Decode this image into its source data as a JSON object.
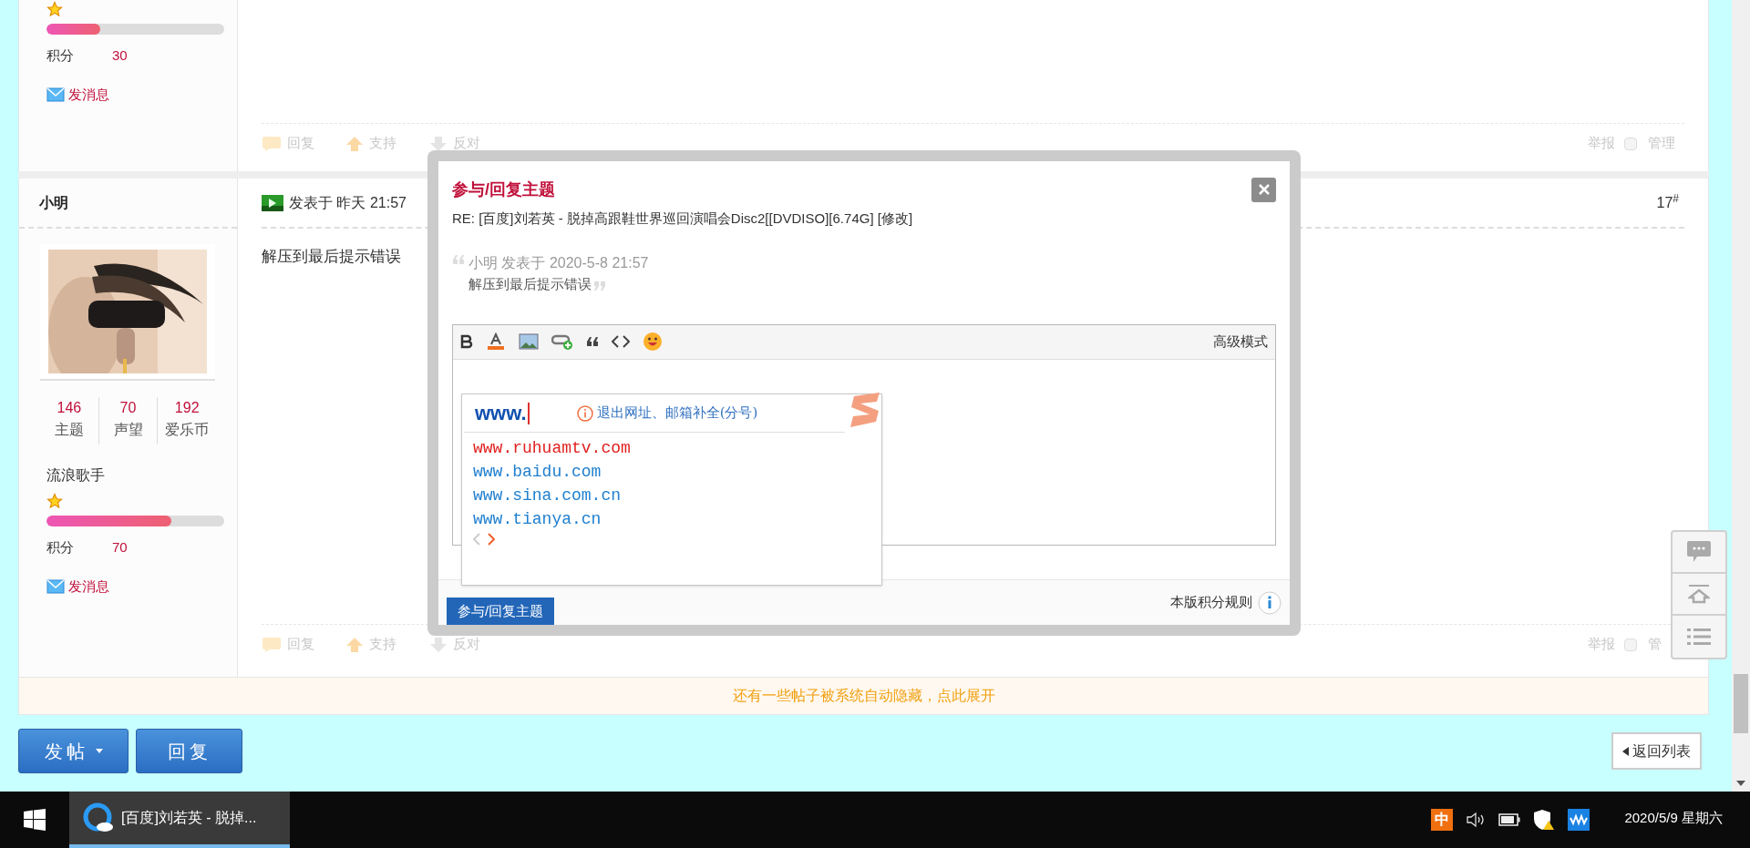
{
  "previous_post": {
    "level": 0.3,
    "points_label": "积分",
    "points": "30",
    "message_link": "发消息",
    "actions": [
      "回复",
      "支持",
      "反对"
    ],
    "report": "举报",
    "manage": "管理",
    "manage_checked": false
  },
  "post": {
    "author": "小明",
    "posted": "发表于 昨天 21:57",
    "floor": "17$^{#}$",
    "body": "解压到最后提示错误",
    "stats": [
      {
        "value": "146",
        "label": "主题"
      },
      {
        "value": "70",
        "label": "声望"
      },
      {
        "value": "192",
        "label": "爱乐币"
      }
    ],
    "rank": "流浪歌手",
    "level": 0.7,
    "points_label": "积分",
    "points": "70",
    "message_link": "发消息",
    "actions": [
      "回复",
      "支持",
      "反对"
    ],
    "report": "举报",
    "manage": "管",
    "manage_checked": false
  },
  "hidden_notice": "还有一些帖子被系统自动隐藏，点此展开",
  "buttons": {
    "new_post": "发帖",
    "reply": "回复",
    "back": "返回列表"
  },
  "modal": {
    "title": "参与/回复主题",
    "subject": "RE: [百度]刘若英 - 脱掉高跟鞋世界巡回演唱会Disc2[[DVDISO][6.74G] [修改]",
    "quote_header": "小明 发表于 2020-5-8 21:57",
    "quote_text": "解压到最后提示错误",
    "editor_mode": "高级模式",
    "submit": "参与/回复主题",
    "rules": "本版积分规则"
  },
  "ime_popup": {
    "typed": "www.",
    "hint": "退出网址、邮箱补全(分号)",
    "suggestions": [
      {
        "text": "www.ruhuamtv.com",
        "selected": true
      },
      {
        "text": "www.baidu.com",
        "selected": false
      },
      {
        "text": "www.sina.com.cn",
        "selected": false
      },
      {
        "text": "www.tianya.cn",
        "selected": false
      }
    ]
  },
  "taskbar": {
    "app": "[百度]刘若英 - 脱掉...",
    "ime": "中",
    "date": "2020/5/9 星期六"
  }
}
